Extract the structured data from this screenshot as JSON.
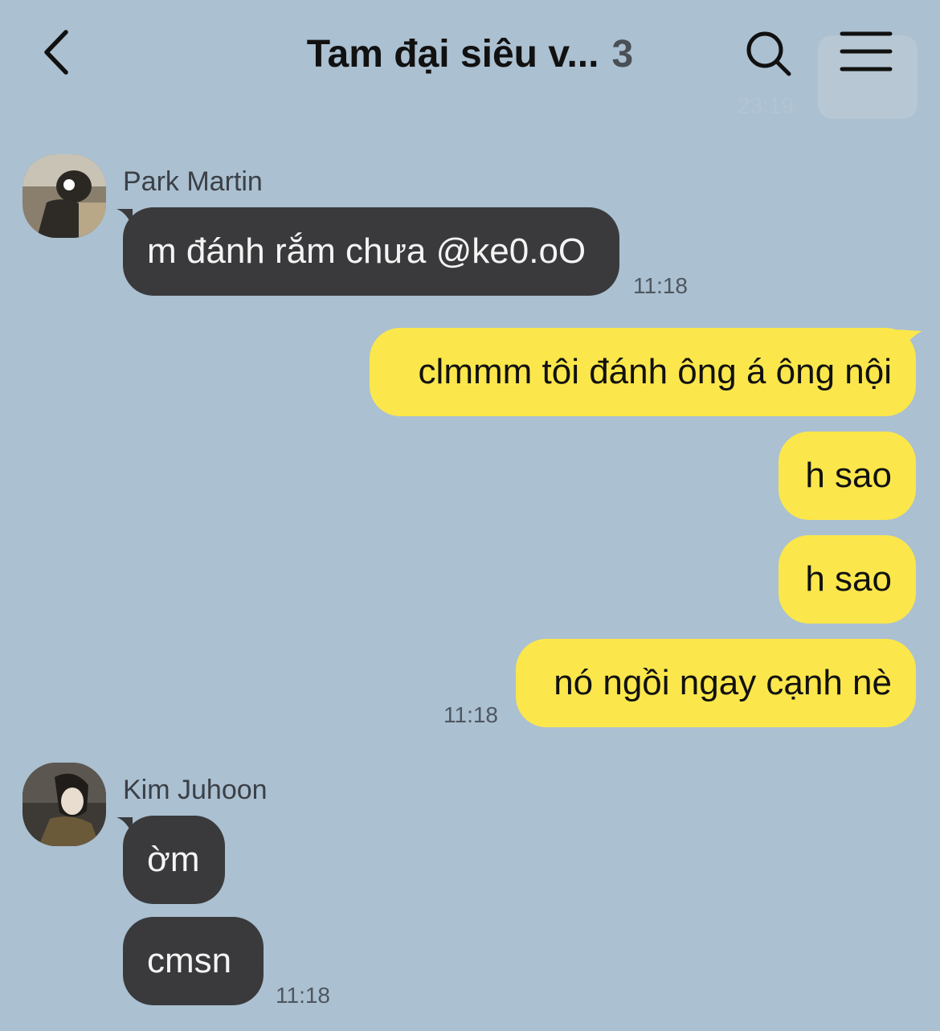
{
  "header": {
    "title": "Tam đại siêu v...",
    "member_count": "3",
    "back_icon": "chevron-left-icon",
    "search_icon": "search-icon",
    "menu_icon": "hamburger-menu-icon"
  },
  "ghost_overlay": {
    "time": "23:19"
  },
  "messages": {
    "park": {
      "sender": "Park Martin",
      "bubble1": "m đánh rắm chưa @ke0.oO",
      "time": "11:18"
    },
    "me": {
      "bubble1": "clmmm tôi đánh ông á ông nội",
      "bubble2": "h sao",
      "bubble3": "h sao",
      "bubble4": "nó ngồi ngay cạnh nè",
      "time": "11:18"
    },
    "kim": {
      "sender": "Kim Juhoon",
      "bubble1": "ờm",
      "bubble2": "cmsn",
      "time": "11:18"
    }
  },
  "colors": {
    "background": "#abc0d1",
    "incoming_bubble": "#3a3a3c",
    "outgoing_bubble": "#fbe74b"
  }
}
